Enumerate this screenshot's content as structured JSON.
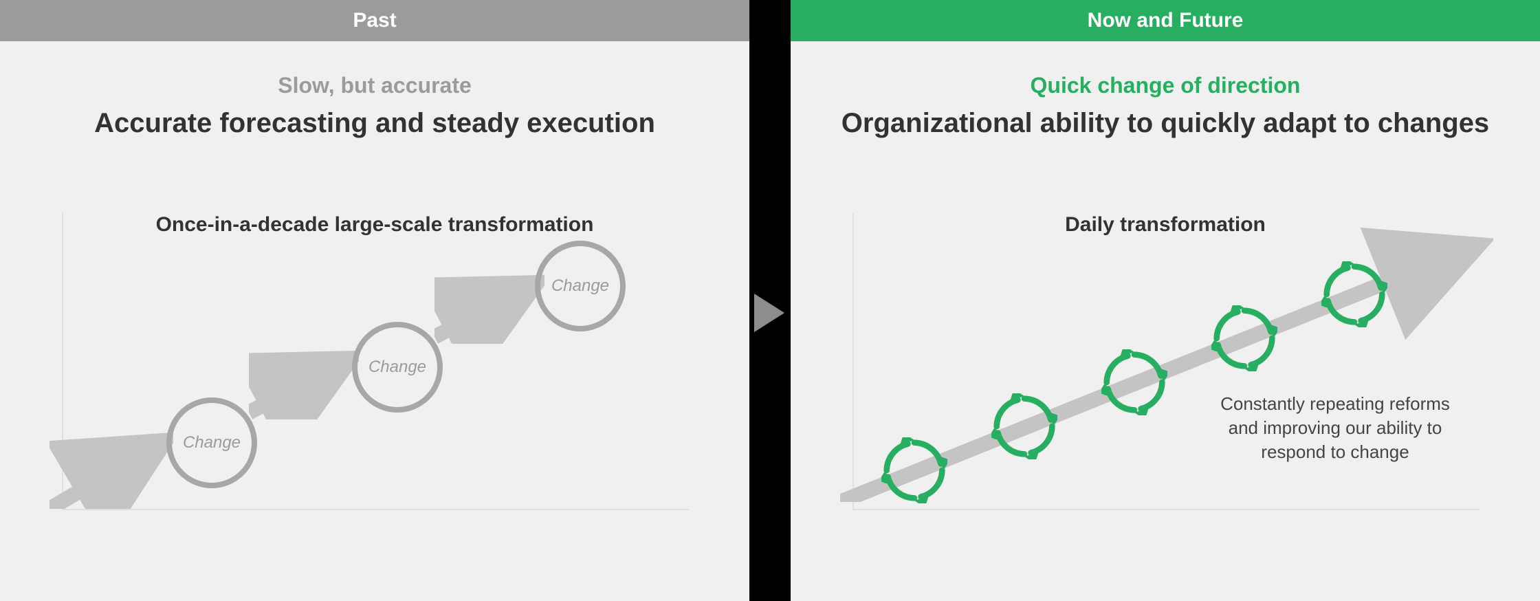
{
  "left": {
    "header": "Past",
    "tag": "Slow, but accurate",
    "title": "Accurate forecasting and steady execution",
    "chart_caption": "Once-in-a-decade large-scale transformation",
    "bubble_label": "Change"
  },
  "right": {
    "header": "Now and Future",
    "tag": "Quick change of direction",
    "title": "Organizational ability to quickly adapt to changes",
    "chart_caption": "Daily transformation",
    "caption": "Constantly repeating reforms and improving our ability to respond to change"
  },
  "colors": {
    "past_header": "#9b9b9b",
    "now_header": "#27ae60",
    "accent_green": "#27ae60",
    "grey_line": "#a7a7a7"
  }
}
